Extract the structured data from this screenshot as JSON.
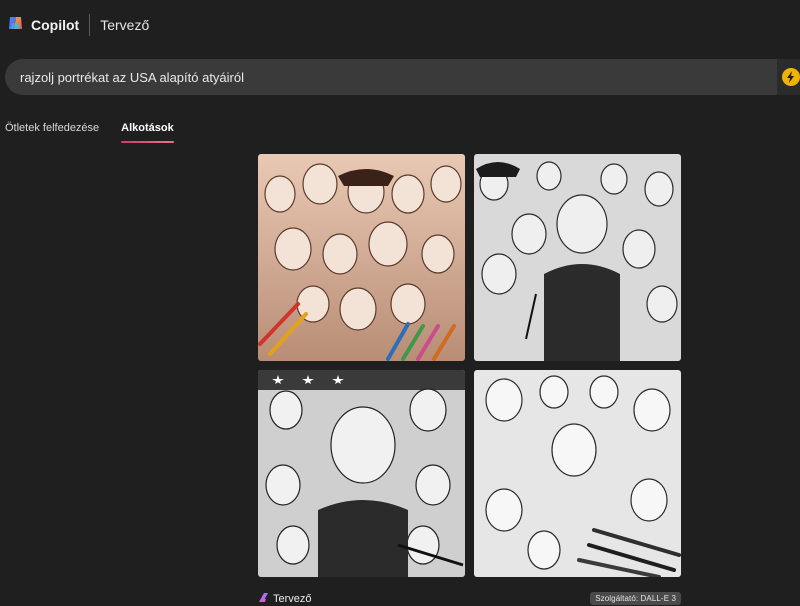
{
  "header": {
    "brand": "Copilot",
    "product": "Tervező"
  },
  "search": {
    "query": "rajzolj portrékat az USA alapító atyáiról"
  },
  "tabs": [
    {
      "label": "Ötletek felfedezése",
      "active": false
    },
    {
      "label": "Alkotások",
      "active": true
    }
  ],
  "images": [
    {
      "style": "colored-pencil sepia",
      "accent": "#c8a58a"
    },
    {
      "style": "graphite sketch",
      "accent": "#cfcfcf"
    },
    {
      "style": "black and white with flag",
      "accent": "#bdbdbd"
    },
    {
      "style": "pencil portraits with pencils",
      "accent": "#d6d6d6"
    }
  ],
  "footer": {
    "brand_label": "Tervező",
    "powered_by": "Szolgáltató: DALL-E 3"
  },
  "icons": {
    "logo": "copilot-logo-icon",
    "submit": "lightning-icon",
    "footer_brand": "designer-icon"
  },
  "colors": {
    "background": "#1f1f1f",
    "search_bg": "#3a3a3a",
    "tab_underline": "#e0486f",
    "submit_button": "#f0b400"
  }
}
